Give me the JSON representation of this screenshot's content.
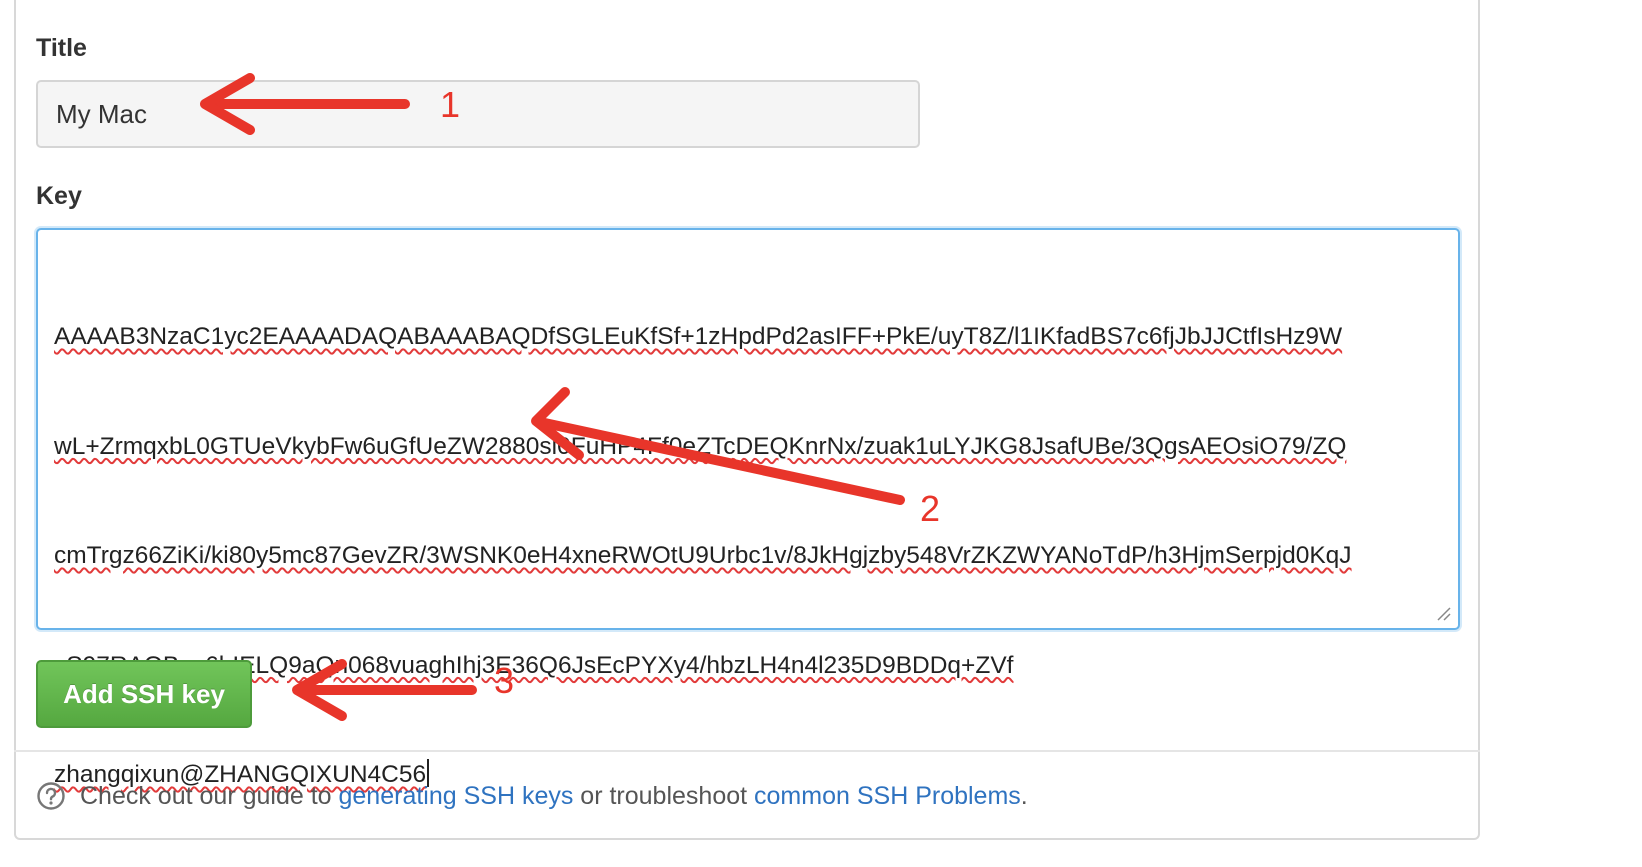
{
  "form": {
    "title_label": "Title",
    "title_value": "My Mac",
    "key_label": "Key",
    "key_lines": [
      "AAAAB3NzaC1yc2EAAAADAQABAAABAQDfSGLEuKfSf+1zHpdPd2asIFF+PkE/uyT8Z/l1IKfadBS7c6fjJbJJCtfIsHz9W",
      "wL+ZrmqxbL0GTUeVkybFw6uGfUeZW2880si0FuHP4Ff0eZTcDEQKnrNx/zuak1uLYJKG8JsafUBe/3QgsAEOsiO79/ZQ",
      "cmTrgz66ZiKi/ki80y5mc87GevZR/3WSNK0eH4xneRWOtU9Urbc1v/8JkHgjzby548VrZKZWYANoTdP/h3HjmSerpjd0KqJ",
      "zS97RAOBev6hIELQ9aQn068vuaghIhj3E36Q6JsEcPYXy4/hbzLH4n4l235D9BDDq+ZVf",
      "zhangqixun@ZHANGQIXUN4C56"
    ],
    "submit_label": "Add SSH key"
  },
  "footer": {
    "prefix": "Check out our guide to ",
    "link1": "generating SSH keys",
    "middle": " or troubleshoot ",
    "link2": "common SSH Problems",
    "suffix": "."
  },
  "annotations": {
    "label_1": "1",
    "label_2": "2",
    "label_3": "3",
    "color": "#e8352a"
  },
  "colors": {
    "button_green": "#5cb646",
    "link_blue": "#2f73c0",
    "focus_blue": "#68b3ea"
  }
}
